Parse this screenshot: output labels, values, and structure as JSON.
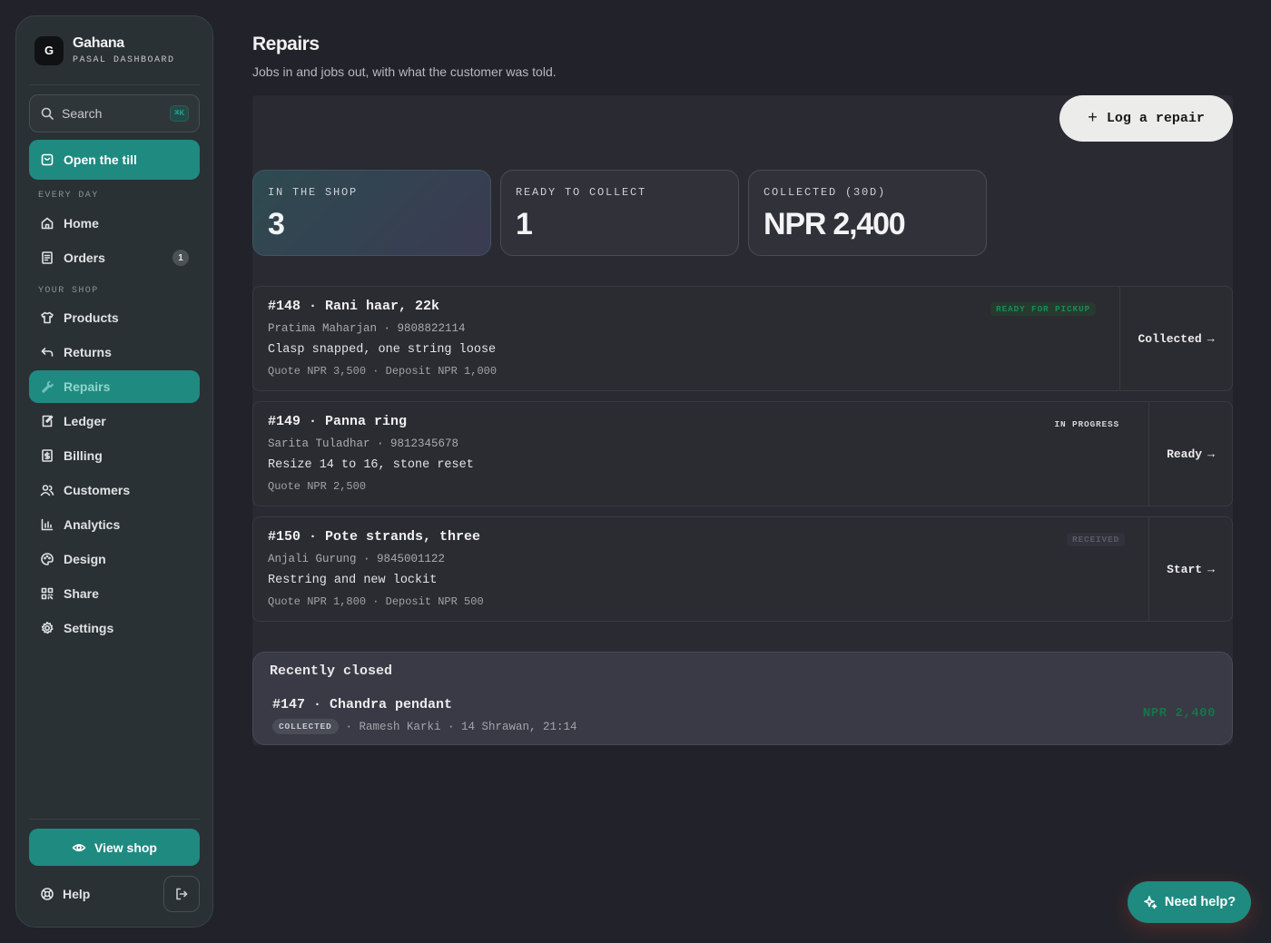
{
  "sidebar": {
    "brand": {
      "logo": "G",
      "name": "Gahana",
      "subtitle": "PASAL DASHBOARD"
    },
    "search": {
      "placeholder": "Search",
      "shortcut": "⌘K"
    },
    "open_till": "Open the till",
    "sections": {
      "every_day": "EVERY DAY",
      "your_shop": "YOUR SHOP"
    },
    "items": {
      "home": "Home",
      "orders": "Orders",
      "orders_badge": "1",
      "products": "Products",
      "returns": "Returns",
      "repairs": "Repairs",
      "ledger": "Ledger",
      "billing": "Billing",
      "customers": "Customers",
      "analytics": "Analytics",
      "design": "Design",
      "share": "Share",
      "settings": "Settings"
    },
    "view_shop": "View shop",
    "help": "Help"
  },
  "page": {
    "title": "Repairs",
    "subtitle": "Jobs in and jobs out, with what the customer was told.",
    "log_button": "Log a repair"
  },
  "stats": [
    {
      "label": "IN THE SHOP",
      "value": "3"
    },
    {
      "label": "READY TO COLLECT",
      "value": "1"
    },
    {
      "label": "COLLECTED (30D)",
      "value": "NPR 2,400"
    }
  ],
  "jobs": [
    {
      "title": "#148 · Rani haar, 22k",
      "customer": "Pratima Maharjan · 9808822114",
      "description": "Clasp snapped, one string loose",
      "quote": "Quote NPR 3,500 · Deposit NPR 1,000",
      "status": "READY FOR PICKUP",
      "action": "Collected"
    },
    {
      "title": "#149 · Panna ring",
      "customer": "Sarita Tuladhar · 9812345678",
      "description": "Resize 14 to 16, stone reset",
      "quote": "Quote NPR 2,500",
      "status": "IN PROGRESS",
      "action": "Ready"
    },
    {
      "title": "#150 · Pote strands, three",
      "customer": "Anjali Gurung · 9845001122",
      "description": "Restring and new lockit",
      "quote": "Quote NPR 1,800 · Deposit NPR 500",
      "status": "RECEIVED",
      "action": "Start"
    }
  ],
  "recent": {
    "title": "Recently closed",
    "item": {
      "name": "#147 · Chandra pendant",
      "status": "COLLECTED",
      "meta": "· Ramesh Karki · 14 Shrawan, 21:14",
      "amount": "NPR 2,400"
    }
  },
  "need_help": "Need help?",
  "colors": {
    "accent": "#1f8a80",
    "ready": "#1c8a55",
    "background": "#22232a"
  }
}
